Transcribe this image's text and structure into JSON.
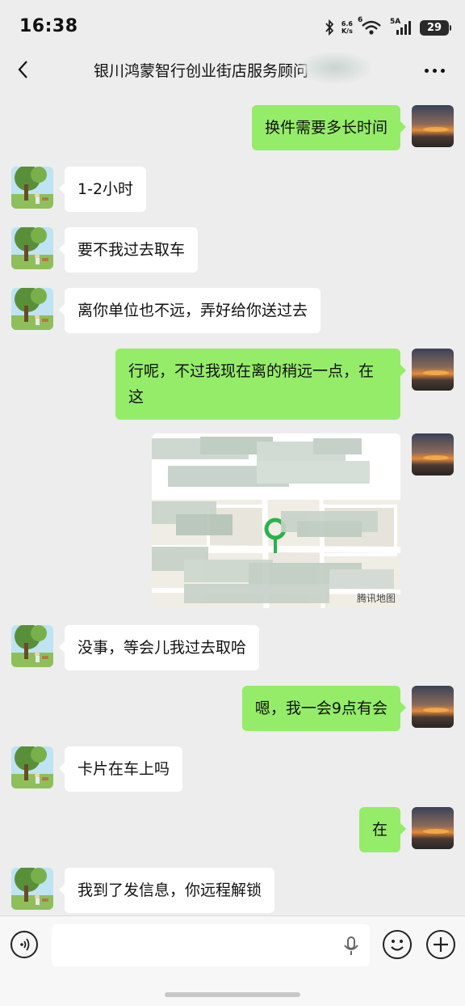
{
  "status_bar": {
    "time": "16:38",
    "net_speed_value": "6.6",
    "net_speed_unit": "K/s",
    "wifi_label": "6",
    "signal_label": "5A",
    "battery": "29",
    "icons": [
      "bluetooth-icon",
      "wifi-icon",
      "signal-icon",
      "battery-icon"
    ]
  },
  "nav": {
    "title": "银川鸿蒙智行创业街店服务顾问",
    "back_icon": "chevron-left-icon",
    "more_icon": "more-dots-icon"
  },
  "messages": [
    {
      "side": "out",
      "text": "换件需要多长时间"
    },
    {
      "side": "in",
      "text": "1-2小时"
    },
    {
      "side": "in",
      "text": "要不我过去取车"
    },
    {
      "side": "in",
      "text": "离你单位也不远，弄好给你送过去"
    },
    {
      "side": "out",
      "text": "行呢，不过我现在离的稍远一点，在这"
    },
    {
      "side": "out",
      "type": "location",
      "map_credit": "腾讯地图"
    },
    {
      "side": "in",
      "text": "没事，等会儿我过去取哈"
    },
    {
      "side": "out",
      "text": "嗯，我一会9点有会"
    },
    {
      "side": "in",
      "text": "卡片在车上吗"
    },
    {
      "side": "out",
      "text": "在"
    },
    {
      "side": "in",
      "text": "我到了发信息，你远程解锁"
    }
  ],
  "input_bar": {
    "placeholder": "",
    "icons": [
      "voice-icon",
      "microphone-icon",
      "emoji-icon",
      "plus-icon"
    ]
  },
  "colors": {
    "background": "#ededed",
    "outgoing_bubble": "#95ec69",
    "incoming_bubble": "#ffffff"
  }
}
